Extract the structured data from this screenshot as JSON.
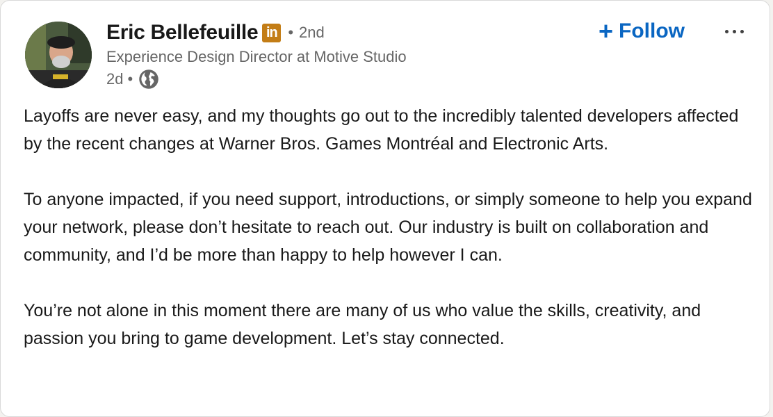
{
  "post": {
    "author": {
      "name": "Eric Bellefeuille",
      "badge": "in",
      "separator": "•",
      "connection_degree": "2nd",
      "headline": "Experience Design Director at Motive Studio",
      "time_ago": "2d",
      "visibility_separator": "•",
      "visibility_icon": "globe-icon"
    },
    "actions": {
      "follow_icon": "+",
      "follow_label": "Follow",
      "more_icon": "ellipsis-icon"
    },
    "body": {
      "paragraph_1": "Layoffs are never easy, and my thoughts go out to the incredibly talented developers affected by the recent changes at Warner Bros. Games Montréal and Electronic Arts.",
      "paragraph_2": "To anyone impacted, if you need support, introductions, or simply someone to help you expand your network, please don’t hesitate to reach out. Our industry is built on collaboration and community, and I’d be more than happy to help however I can.",
      "paragraph_3": "You’re not alone in this moment there are many of us who value the skills, creativity, and passion you bring to game development. Let’s stay connected."
    }
  },
  "colors": {
    "accent": "#0a66c2",
    "badge": "#c37d16",
    "secondary_text": "#666666"
  }
}
